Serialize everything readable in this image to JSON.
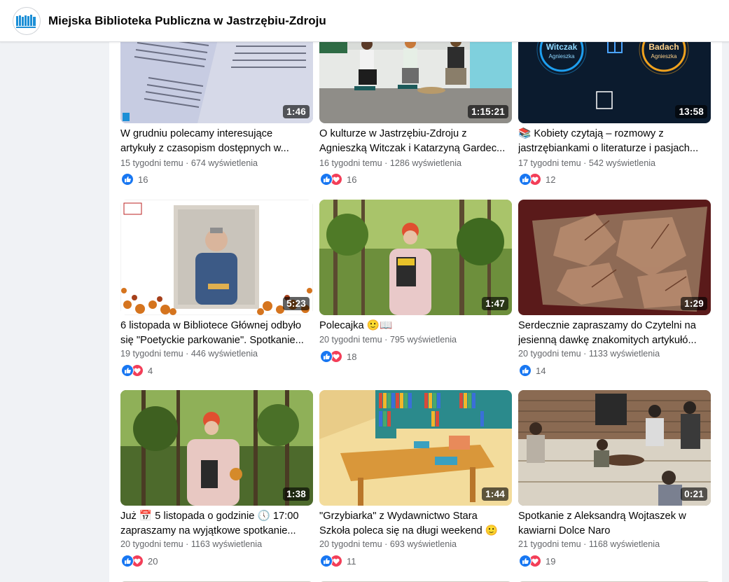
{
  "header": {
    "page_name": "Miejska Biblioteka Publiczna w Jastrzębiu-Zdroju",
    "logo_icon": "library-books-logo-icon"
  },
  "colors": {
    "like_blue": "#1877f2",
    "love_red": "#f33e58",
    "meta_gray": "#65676b",
    "background": "#f0f2f5"
  },
  "videos": [
    {
      "title": "W grudniu polecamy interesujące artykuły z czasopism dostępnych w...",
      "duration": "1:46",
      "ago": "15 tygodni temu",
      "views": "674 wyświetlenia",
      "reaction_count": "16",
      "reactions": [
        "like"
      ]
    },
    {
      "title": "O kulturze w Jastrzębiu-Zdroju z Agnieszką Witczak i Katarzyną Gardec...",
      "duration": "1:15:21",
      "ago": "16 tygodni temu",
      "views": "1286 wyświetlenia",
      "reaction_count": "16",
      "reactions": [
        "like",
        "love"
      ]
    },
    {
      "title": "📚 Kobiety czytają – rozmowy z jastrzębiankami o literaturze i pasjach...",
      "duration": "13:58",
      "ago": "17 tygodni temu",
      "views": "542 wyświetlenia",
      "reaction_count": "12",
      "reactions": [
        "like",
        "love"
      ]
    },
    {
      "title": "6 listopada w Bibliotece Głównej odbyło się \"Poetyckie parkowanie\". Spotkanie...",
      "duration": "5:23",
      "ago": "19 tygodni temu",
      "views": "446 wyświetlenia",
      "reaction_count": "4",
      "reactions": [
        "like",
        "love"
      ]
    },
    {
      "title": "Polecajka 🙂📖",
      "duration": "1:47",
      "ago": "20 tygodni temu",
      "views": "795 wyświetlenia",
      "reaction_count": "18",
      "reactions": [
        "like",
        "love"
      ]
    },
    {
      "title": "Serdecznie zapraszamy do Czytelni na jesienną dawkę znakomitych artykułó...",
      "duration": "1:29",
      "ago": "20 tygodni temu",
      "views": "1133 wyświetlenia",
      "reaction_count": "14",
      "reactions": [
        "like"
      ]
    },
    {
      "title": "Już 📅 5 listopada o godzinie 🕔 17:00 zapraszamy na wyjątkowe spotkanie...",
      "duration": "1:38",
      "ago": "20 tygodni temu",
      "views": "1163 wyświetlenia",
      "reaction_count": "20",
      "reactions": [
        "like",
        "love"
      ]
    },
    {
      "title": "\"Grzybiarka\" z Wydawnictwo Stara Szkoła poleca się na długi weekend 🙂",
      "duration": "1:44",
      "ago": "20 tygodni temu",
      "views": "693 wyświetlenia",
      "reaction_count": "11",
      "reactions": [
        "like",
        "love"
      ]
    },
    {
      "title": "Spotkanie z Aleksandrą Wojtaszek w kawiarni Dolce Naro",
      "duration": "0:21",
      "ago": "21 tygodni temu",
      "views": "1168 wyświetlenia",
      "reaction_count": "19",
      "reactions": [
        "like",
        "love"
      ]
    }
  ],
  "thumbnail_logo_texts": {
    "witczak": "Witczak",
    "witczak_sub": "Agnieszka",
    "badach": "Badach",
    "badach_sub": "Agnieszka"
  }
}
